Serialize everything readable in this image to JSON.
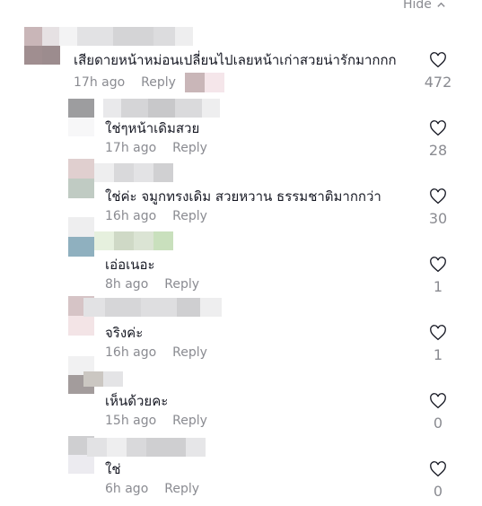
{
  "header": {
    "hide_label": "Hide"
  },
  "colors": {
    "text": "#161823",
    "muted": "#8a8b91",
    "accent": "#fe2c55"
  },
  "comments": [
    {
      "text": "เสียดายหน้าหม่อนเปลี่ยนไปเลยหน้าเก่าสวยน่ารักมากกก",
      "time": "17h ago",
      "reply": "Reply",
      "likes": "472"
    },
    {
      "text": "ใช่ๆหน้าเดิมสวย",
      "time": "17h ago",
      "reply": "Reply",
      "likes": "28"
    },
    {
      "text": "ใช่ค่ะ จมูกทรงเดิม สวยหวาน ธรรมชาติมากกว่า",
      "time": "16h ago",
      "reply": "Reply",
      "likes": "30"
    },
    {
      "text": "เอ่อเนอะ",
      "time": "8h ago",
      "reply": "Reply",
      "likes": "1"
    },
    {
      "text": "จริงค่ะ",
      "time": "16h ago",
      "reply": "Reply",
      "likes": "1"
    },
    {
      "text": "เห็นด้วยคะ",
      "time": "15h ago",
      "reply": "Reply",
      "likes": "0"
    },
    {
      "text": "ใช่",
      "time": "6h ago",
      "reply": "Reply",
      "likes": "0"
    }
  ]
}
